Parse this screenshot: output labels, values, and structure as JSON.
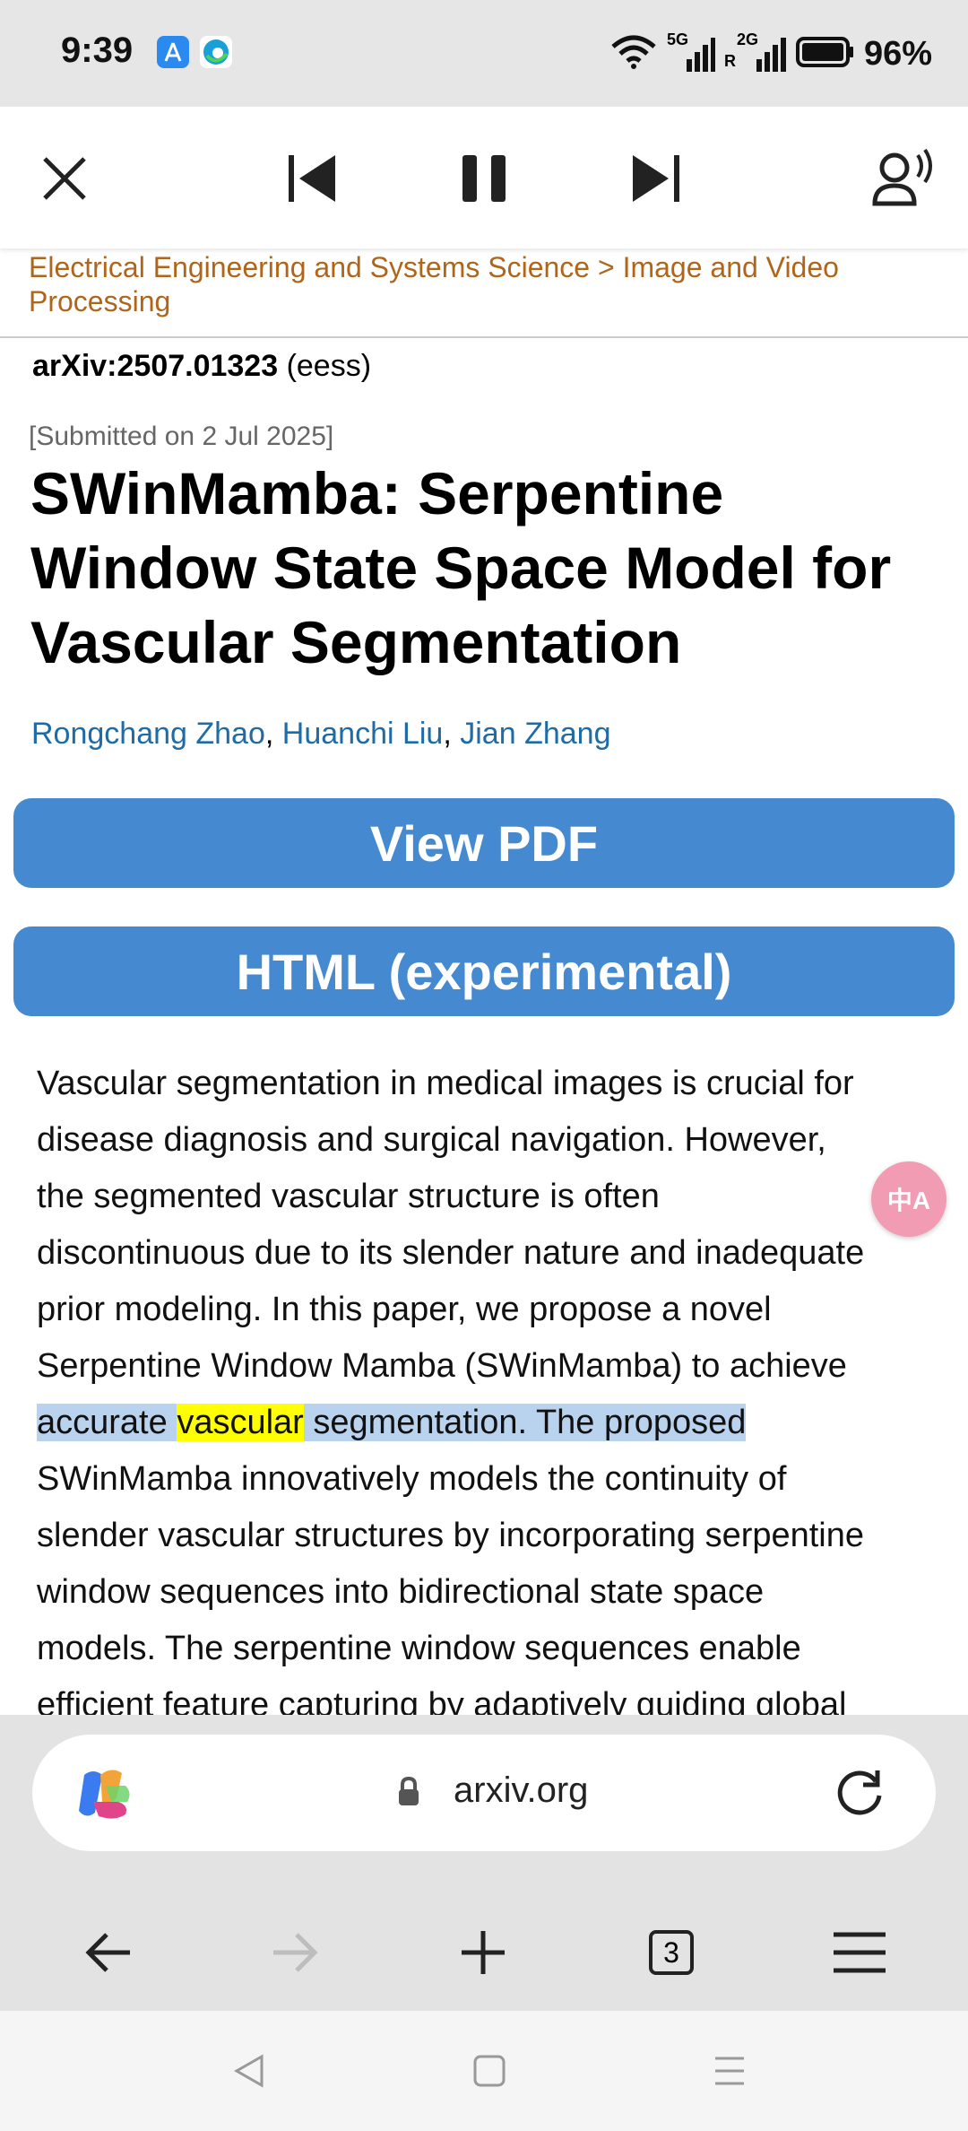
{
  "status_bar": {
    "time": "9:39",
    "battery": "96%",
    "network_1": "5G",
    "network_2": "2G",
    "roaming": "R"
  },
  "media_toolbar": {
    "icons": [
      "close-icon",
      "skip-previous-icon",
      "pause-icon",
      "skip-next-icon",
      "voice-icon"
    ]
  },
  "page": {
    "breadcrumb": "Electrical Engineering and Systems Science > Image and Video Processing",
    "arxiv_id": "arXiv:2507.01323",
    "category": "(eess)",
    "submitted": "[Submitted on 2 Jul 2025]",
    "title": "SWinMamba: Serpentine Window State Space Model for Vascular Segmentation",
    "authors": [
      "Rongchang Zhao",
      "Huanchi Liu",
      "Jian Zhang"
    ],
    "author_separator": ",",
    "view_pdf": "View PDF",
    "html_experimental": "HTML (experimental)",
    "abstract_lines": [
      "Vascular segmentation in medical images is crucial for",
      "disease diagnosis and surgical navigation. However,",
      "the segmented vascular structure is often",
      "discontinuous due to its slender nature and inadequate",
      "prior modeling. In this paper, we propose a novel",
      "Serpentine Window Mamba (SWinMamba) to achieve"
    ],
    "selected_line": {
      "before": "accurate ",
      "highlight": "vascular",
      "after": " segmentation. The proposed"
    },
    "abstract_lines_after": [
      "SWinMamba innovatively models the continuity of",
      "slender vascular structures by incorporating serpentine",
      "window sequences into bidirectional state space",
      "models. The serpentine window sequences enable",
      "efficient feature capturing by adaptively guiding global"
    ],
    "translate_fab": "中A"
  },
  "browser": {
    "url": "arxiv.org",
    "tab_count": "3"
  },
  "colors": {
    "button_blue": "#4589d0",
    "breadcrumb": "#b0661a",
    "author_link": "#1f6ba5",
    "selection": "#b9d3ef",
    "highlight": "#ffff00"
  }
}
